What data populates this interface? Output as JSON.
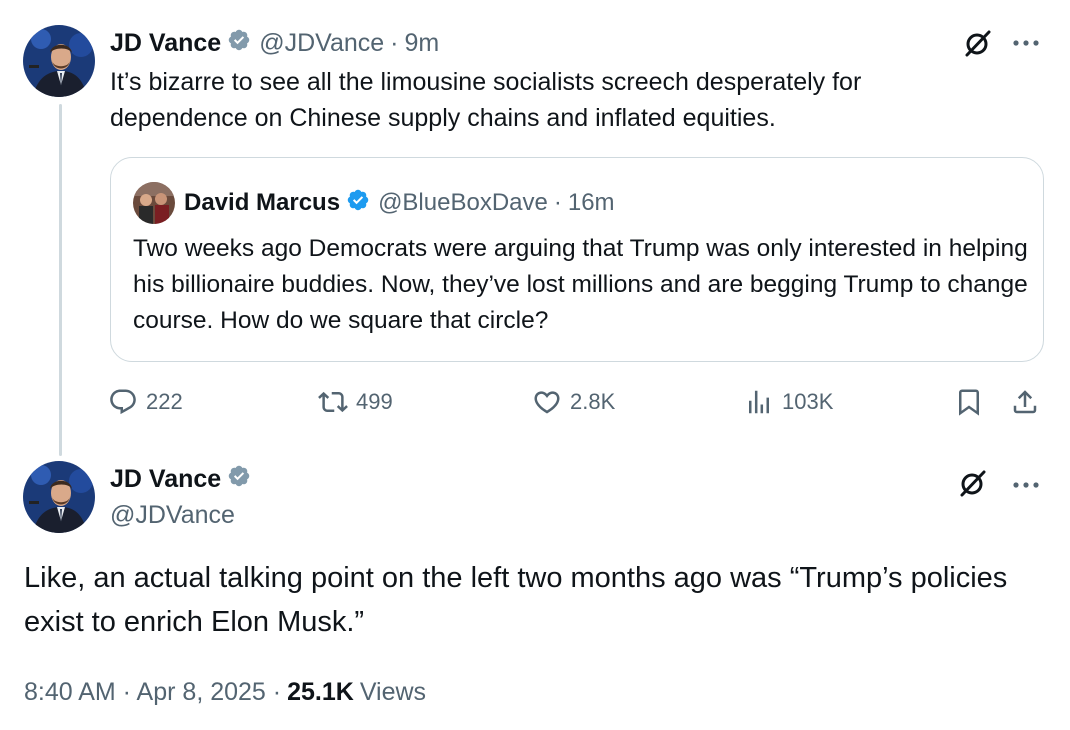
{
  "main_post": {
    "author_name": "JD Vance",
    "handle": "@JDVance",
    "separator": "·",
    "time": "9m",
    "text": "It’s bizarre to see all the limousine socialists screech desperately for dependence on Chinese supply chains and inflated equities.",
    "quoted_post": {
      "author_name": "David Marcus",
      "handle": "@BlueBoxDave",
      "separator": "·",
      "time": "16m",
      "text": "Two weeks ago Democrats were arguing that Trump was only interested in helping his billionaire buddies. Now, they’ve lost millions and are begging Trump to change course. How do we square that circle?"
    },
    "actions": {
      "replies": "222",
      "reposts": "499",
      "likes": "2.8K",
      "views": "103K"
    }
  },
  "reply_post": {
    "author_name": "JD Vance",
    "handle": "@JDVance",
    "text": "Like, an actual talking point on the left two months ago was “Trump’s policies exist to enrich Elon Musk.”",
    "timestamp": "8:40 AM · Apr 8, 2025 ·",
    "views_count": "25.1K",
    "views_label": "Views"
  },
  "colors": {
    "text_primary": "#0f1419",
    "text_secondary": "#536471",
    "verified_blue": "#1d9bf0",
    "verified_gray": "#829aab",
    "border": "#cfd9de"
  },
  "icons": [
    "verified-badge-icon",
    "grok-icon",
    "more-icon",
    "reply-icon",
    "repost-icon",
    "like-icon",
    "views-icon",
    "bookmark-icon",
    "share-icon"
  ]
}
